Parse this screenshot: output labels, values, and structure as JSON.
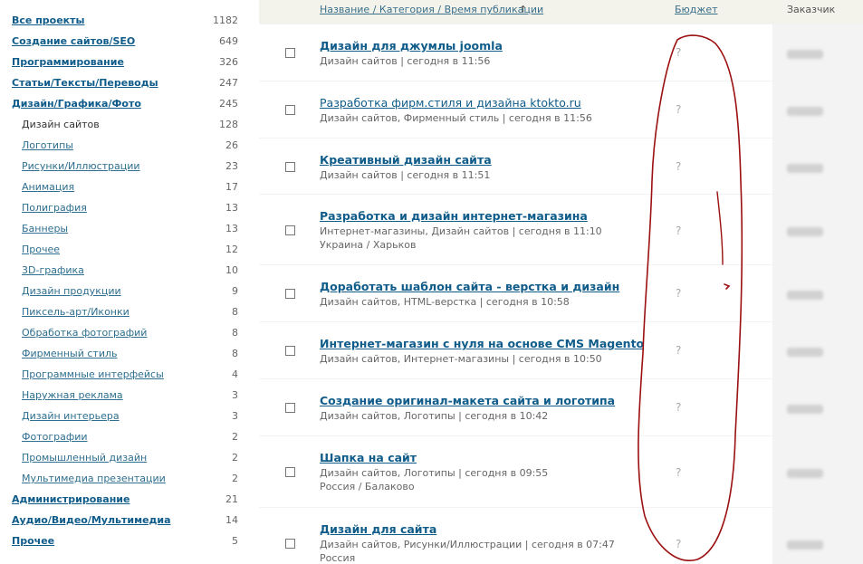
{
  "sidebar": {
    "items": [
      {
        "label": "Все проекты",
        "count": "1182",
        "level": "top"
      },
      {
        "label": "Создание сайтов/SEO",
        "count": "649",
        "level": "top"
      },
      {
        "label": "Программирование",
        "count": "326",
        "level": "top"
      },
      {
        "label": "Статьи/Тексты/Переводы",
        "count": "247",
        "level": "top"
      },
      {
        "label": "Дизайн/Графика/Фото",
        "count": "245",
        "level": "top"
      },
      {
        "label": "Дизайн сайтов",
        "count": "128",
        "level": "sub-active"
      },
      {
        "label": "Логотипы",
        "count": "26",
        "level": "sub"
      },
      {
        "label": "Рисунки/Иллюстрации",
        "count": "23",
        "level": "sub"
      },
      {
        "label": "Анимация",
        "count": "17",
        "level": "sub"
      },
      {
        "label": "Полиграфия",
        "count": "13",
        "level": "sub"
      },
      {
        "label": "Баннеры",
        "count": "13",
        "level": "sub"
      },
      {
        "label": "Прочее",
        "count": "12",
        "level": "sub"
      },
      {
        "label": "3D-графика",
        "count": "10",
        "level": "sub"
      },
      {
        "label": "Дизайн продукции",
        "count": "9",
        "level": "sub"
      },
      {
        "label": "Пиксель-арт/Иконки",
        "count": "8",
        "level": "sub"
      },
      {
        "label": "Обработка фотографий",
        "count": "8",
        "level": "sub"
      },
      {
        "label": "Фирменный стиль",
        "count": "8",
        "level": "sub"
      },
      {
        "label": "Программные интерфейсы",
        "count": "4",
        "level": "sub"
      },
      {
        "label": "Наружная реклама",
        "count": "3",
        "level": "sub"
      },
      {
        "label": "Дизайн интерьера",
        "count": "3",
        "level": "sub"
      },
      {
        "label": "Фотографии",
        "count": "2",
        "level": "sub"
      },
      {
        "label": "Промышленный дизайн",
        "count": "2",
        "level": "sub"
      },
      {
        "label": "Мультимедиа презентации",
        "count": "2",
        "level": "sub"
      },
      {
        "label": "Администрирование",
        "count": "21",
        "level": "top"
      },
      {
        "label": "Аудио/Видео/Мультимедиа",
        "count": "14",
        "level": "top"
      },
      {
        "label": "Прочее",
        "count": "5",
        "level": "top"
      }
    ]
  },
  "header": {
    "title_col": "Название / Категория / Время публикации",
    "sort_arrow": "↑",
    "budget_col": "Бюджет",
    "client_col": "Заказчик"
  },
  "projects": [
    {
      "title": "Дизайн для джумлы joomla",
      "meta": "Дизайн сайтов | сегодня в 11:56",
      "location": "",
      "budget": "?",
      "bold": true
    },
    {
      "title": "Разработка фирм.стиля и дизайна ktokto.ru",
      "meta": "Дизайн сайтов, Фирменный стиль | сегодня в 11:56",
      "location": "",
      "budget": "?",
      "bold": false
    },
    {
      "title": "Креативный дизайн сайта",
      "meta": "Дизайн сайтов | сегодня в 11:51",
      "location": "",
      "budget": "?",
      "bold": true
    },
    {
      "title": "Разработка и дизайн интернет-магазина",
      "meta": "Интернет-магазины, Дизайн сайтов | сегодня в 11:10",
      "location": "Украина / Харьков",
      "budget": "?",
      "bold": true
    },
    {
      "title": "Доработать шаблон сайта - верстка и дизайн",
      "meta": "Дизайн сайтов, HTML-верстка | сегодня в 10:58",
      "location": "",
      "budget": "?",
      "bold": true
    },
    {
      "title": "Интернет-магазин с нуля на основе CMS Magento",
      "meta": "Дизайн сайтов, Интернет-магазины | сегодня в 10:50",
      "location": "",
      "budget": "?",
      "bold": true
    },
    {
      "title": "Создание оригинал-макета сайта и логотипа",
      "meta": "Дизайн сайтов, Логотипы | сегодня в 10:42",
      "location": "",
      "budget": "?",
      "bold": true
    },
    {
      "title": "Шапка на сайт",
      "meta": "Дизайн сайтов, Логотипы | сегодня в 09:55",
      "location": "Россия / Балаково",
      "budget": "?",
      "bold": true
    },
    {
      "title": "Дизайн для сайта",
      "meta": "Дизайн сайтов, Рисунки/Иллюстрации | сегодня в 07:47",
      "location": "Россия",
      "budget": "?",
      "bold": true
    }
  ],
  "colors": {
    "link": "#0f5c8a",
    "scribble": "#9b1010",
    "header_bg": "#f3f3ec"
  }
}
